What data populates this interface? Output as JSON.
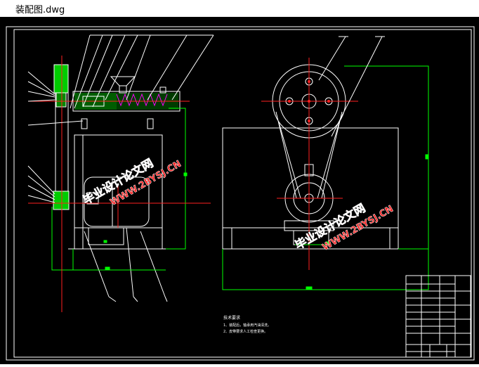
{
  "window": {
    "title": "装配图.dwg"
  },
  "watermark": {
    "text_cn": "毕业设计论文网",
    "text_url": "WWW.2BYSJ.CN"
  },
  "tech_requirements": {
    "heading": "技术要求",
    "line1": "1、装配后，轴承用汽油清洗。",
    "line2": "2、皮带要求人工检查更换。"
  },
  "colors": {
    "background": "#000000",
    "frame": "#ffffff",
    "green": "#00ff00",
    "red": "#ff0000",
    "magenta": "#ff00ff",
    "watermark": "#ff2020"
  }
}
